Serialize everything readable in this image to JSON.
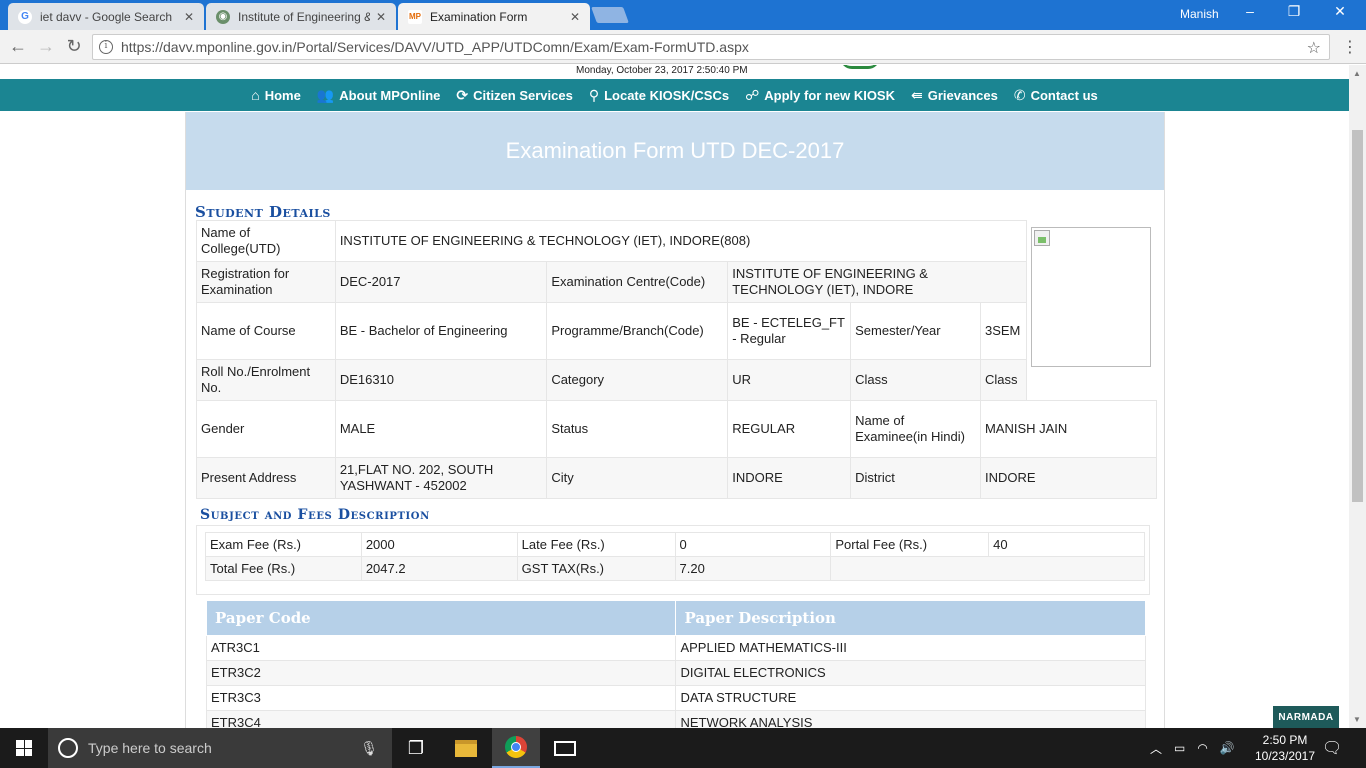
{
  "browser": {
    "tabs": [
      {
        "title": "iet davv - Google Search",
        "favicon": "G"
      },
      {
        "title": "Institute of Engineering &",
        "favicon": "seal"
      },
      {
        "title": "Examination Form",
        "favicon": "mponline"
      }
    ],
    "user": "Manish",
    "url": "https://davv.mponline.gov.in/Portal/Services/DAVV/UTD_APP/UTDComn/Exam/Exam-FormUTD.aspx"
  },
  "header": {
    "datetime": "Monday, October 23, 2017 2:50:40 PM"
  },
  "nav": {
    "items": [
      {
        "label": "Home",
        "icon": "home-icon"
      },
      {
        "label": "About MPOnline",
        "icon": "people-icon"
      },
      {
        "label": "Citizen Services",
        "icon": "refresh-icon"
      },
      {
        "label": "Locate KIOSK/CSCs",
        "icon": "map-pin-icon"
      },
      {
        "label": "Apply for new KIOSK",
        "icon": "apply-icon"
      },
      {
        "label": "Grievances",
        "icon": "grievance-icon"
      },
      {
        "label": "Contact us",
        "icon": "phone-icon"
      }
    ]
  },
  "form": {
    "title": "Examination Form UTD DEC-2017",
    "student_heading": "Student Details",
    "fees_heading": "Subject and Fees Description",
    "student": {
      "college_label": "Name of College(UTD)",
      "college": "INSTITUTE OF ENGINEERING & TECHNOLOGY (IET), INDORE(808)",
      "registration_label": "Registration for Examination",
      "registration": "DEC-2017",
      "centre_label": "Examination Centre(Code)",
      "centre": "INSTITUTE OF ENGINEERING & TECHNOLOGY (IET), INDORE",
      "course_label": "Name of Course",
      "course": "BE - Bachelor of Engineering",
      "branch_label": "Programme/Branch(Code)",
      "branch": "BE - ECTELEG_FT - Regular",
      "semester_label": "Semester/Year",
      "semester": "3SEM",
      "roll_label": "Roll No./Enrolment No.",
      "roll": "DE16310",
      "category_label": "Category",
      "category": "UR",
      "class_label": "Class",
      "class": "Class",
      "gender_label": "Gender",
      "gender": "MALE",
      "status_label": "Status",
      "status": "REGULAR",
      "hindi_name_label": "Name of Examinee(in Hindi)",
      "hindi_name": "MANISH JAIN",
      "address_label": "Present Address",
      "address": "21,FLAT NO. 202, SOUTH YASHWANT - 452002",
      "city_label": "City",
      "city": "INDORE",
      "district_label": "District",
      "district": "INDORE"
    },
    "fees": {
      "exam_fee_label": "Exam Fee (Rs.)",
      "exam_fee": "2000",
      "late_fee_label": "Late Fee (Rs.)",
      "late_fee": "0",
      "portal_fee_label": "Portal Fee (Rs.)",
      "portal_fee": "40",
      "total_fee_label": "Total Fee (Rs.)",
      "total_fee": "2047.2",
      "gst_label": "GST TAX(Rs.)",
      "gst": "7.20"
    },
    "papers": {
      "headers": [
        "Paper Code",
        "Paper Description"
      ],
      "rows": [
        {
          "code": "ATR3C1",
          "desc": "APPLIED MATHEMATICS-III"
        },
        {
          "code": "ETR3C2",
          "desc": "DIGITAL ELECTRONICS"
        },
        {
          "code": "ETR3C3",
          "desc": "DATA STRUCTURE"
        },
        {
          "code": "ETR3C4",
          "desc": "NETWORK ANALYSIS"
        }
      ]
    }
  },
  "badge": "NARMADA",
  "taskbar": {
    "search_placeholder": "Type here to search",
    "time": "2:50 PM",
    "date": "10/23/2017"
  }
}
